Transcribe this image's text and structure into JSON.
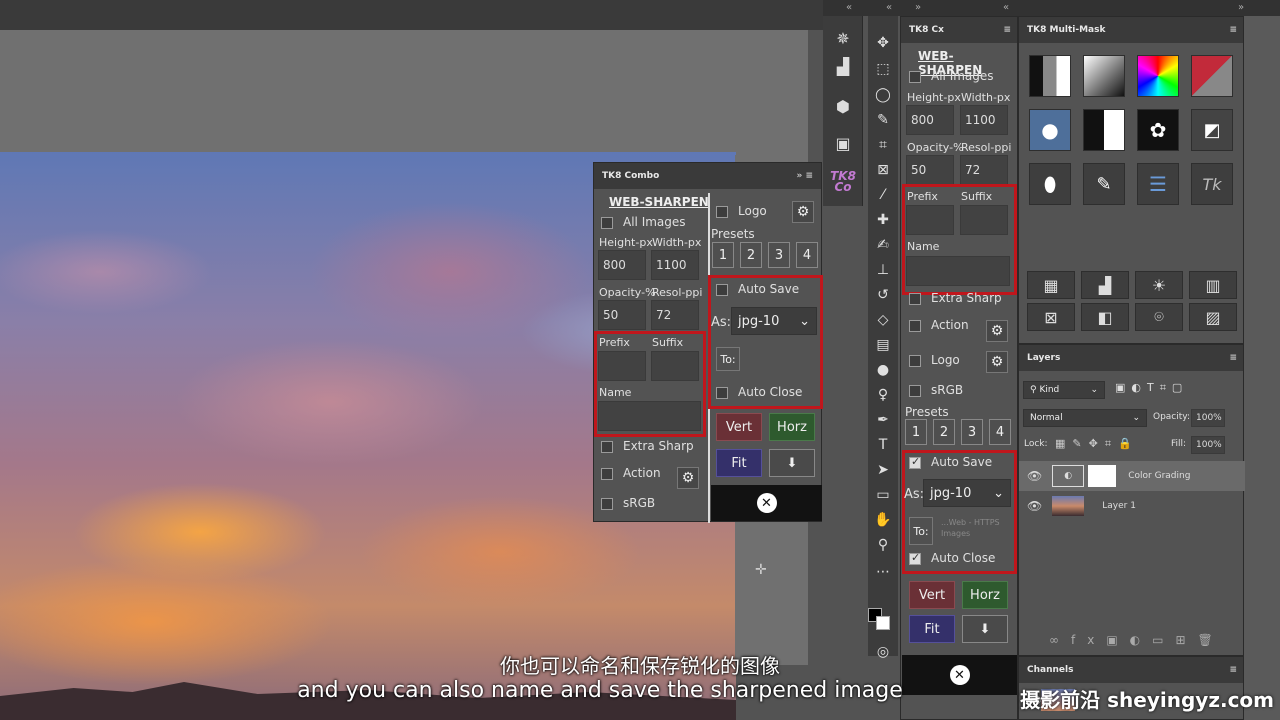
{
  "subtitle": {
    "zh": "你也可以命名和保存锐化的图像",
    "en": "and you can also name and save the sharpened image"
  },
  "watermark": "摄影前沿 sheyingyz.com",
  "collapse_glyphs": {
    "left": "«",
    "right": "»"
  },
  "combo": {
    "title": "TK8 Combo",
    "heading": "WEB-SHARPEN",
    "all_images": "All Images",
    "height_label": "Height-px",
    "width_label": "Width-px",
    "height_value": "800",
    "width_value": "1100",
    "opacity_label": "Opacity-%",
    "resol_label": "Resol-ppi",
    "opacity_value": "50",
    "resol_value": "72",
    "prefix_label": "Prefix",
    "suffix_label": "Suffix",
    "name_label": "Name",
    "extra_sharp": "Extra Sharp",
    "action": "Action",
    "srgb": "sRGB",
    "logo": "Logo",
    "presets_label": "Presets",
    "presets": [
      "1",
      "2",
      "3",
      "4"
    ],
    "auto_save": "Auto Save",
    "as_label": "As:",
    "format": "jpg-10",
    "to_label": "To:",
    "auto_close": "Auto Close",
    "vert": "Vert",
    "horz": "Horz",
    "fit": "Fit",
    "close_glyph": "✕"
  },
  "cx": {
    "title": "TK8 Cx",
    "heading": "WEB-SHARPEN",
    "all_images": "All Images",
    "height_label": "Height-px",
    "width_label": "Width-px",
    "height_value": "800",
    "width_value": "1100",
    "opacity_label": "Opacity-%",
    "resol_label": "Resol-ppi",
    "opacity_value": "50",
    "resol_value": "72",
    "prefix_label": "Prefix",
    "suffix_label": "Suffix",
    "name_label": "Name",
    "extra_sharp": "Extra Sharp",
    "action": "Action",
    "logo": "Logo",
    "srgb": "sRGB",
    "presets_label": "Presets",
    "presets": [
      "1",
      "2",
      "3",
      "4"
    ],
    "auto_save": "Auto Save",
    "as_label": "As:",
    "format": "jpg-10",
    "to_label": "To:",
    "to_path": "...Web - HTTPS Images",
    "auto_close": "Auto Close",
    "vert": "Vert",
    "horz": "Horz",
    "fit": "Fit",
    "close_glyph": "✕"
  },
  "multimask": {
    "title": "TK8 Multi-Mask",
    "tk_label": "Tk"
  },
  "layers": {
    "title": "Layers",
    "kind": "Kind",
    "blend": "Normal",
    "opacity_label": "Opacity:",
    "opacity": "100%",
    "lock_label": "Lock:",
    "fill_label": "Fill:",
    "fill": "100%",
    "items": [
      {
        "name": "Color Grading"
      },
      {
        "name": "Layer 1"
      }
    ],
    "footer_icons": "fx"
  },
  "channels": {
    "title": "Channels"
  },
  "colors": {
    "red_box": "#c0161c",
    "panel_bg": "#535353",
    "vert": "#6a3036",
    "horz": "#2e5a2e",
    "fit": "#34306a"
  }
}
